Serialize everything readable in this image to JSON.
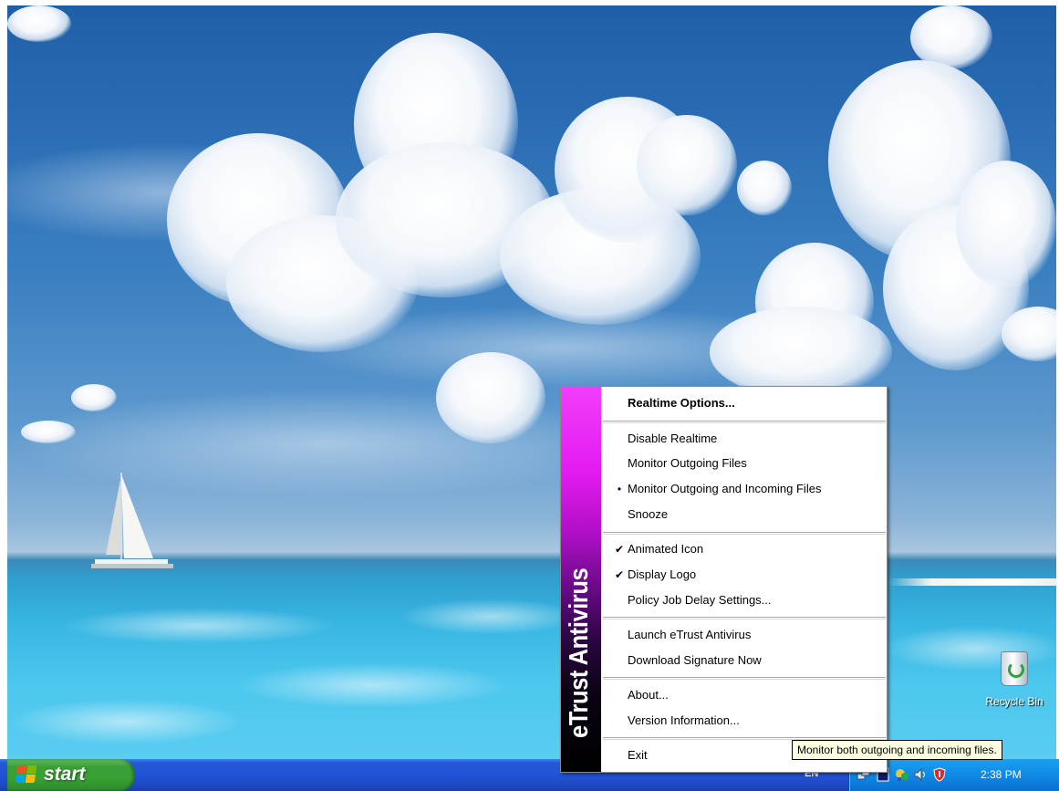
{
  "desktop": {
    "icons": [
      {
        "label": "Recycle Bin",
        "icon": "recycle-bin-icon"
      }
    ]
  },
  "context_menu": {
    "banner_text": "eTrust Antivirus",
    "banner_colors": [
      "#f23dfc",
      "#000000"
    ],
    "items": [
      {
        "label": "Realtime Options...",
        "bold": true,
        "mark": ""
      },
      {
        "label": "Disable Realtime",
        "mark": ""
      },
      {
        "label": "Monitor Outgoing Files",
        "mark": ""
      },
      {
        "label": "Monitor Outgoing and Incoming Files",
        "mark": "•"
      },
      {
        "label": "Snooze",
        "mark": ""
      },
      {
        "label": "Animated Icon",
        "mark": "✔"
      },
      {
        "label": "Display Logo",
        "mark": "✔"
      },
      {
        "label": "Policy Job Delay Settings...",
        "mark": ""
      },
      {
        "label": "Launch eTrust Antivirus",
        "mark": ""
      },
      {
        "label": "Download Signature Now",
        "mark": ""
      },
      {
        "label": "About...",
        "mark": ""
      },
      {
        "label": "Version Information...",
        "mark": ""
      },
      {
        "label": "Exit",
        "mark": ""
      }
    ]
  },
  "tooltip": {
    "text": "Monitor both outgoing and incoming files."
  },
  "taskbar": {
    "start_label": "start",
    "start_color": "#3a9e37",
    "taskbar_color": "#2253d5",
    "language": "EN",
    "tray_icons": [
      "network-icon",
      "monitor-icon",
      "antivirus-icon",
      "speaker-icon",
      "shield-icon"
    ],
    "clock": "2:38 PM"
  }
}
